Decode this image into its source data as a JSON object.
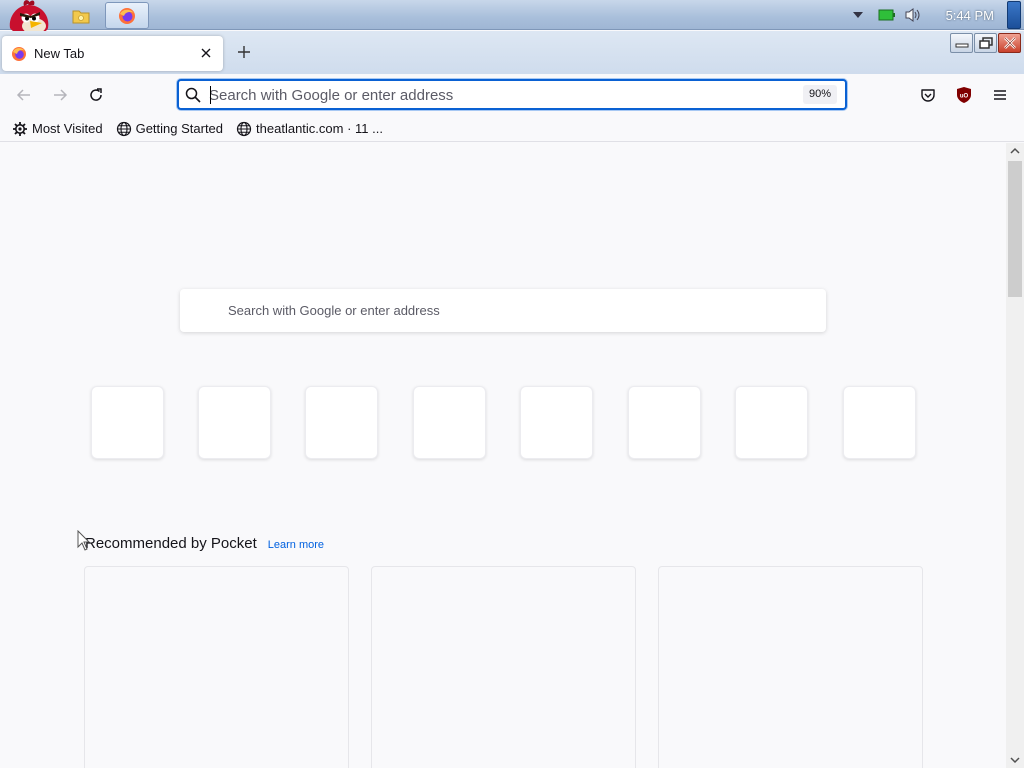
{
  "taskbar": {
    "clock": "5:44 PM",
    "icons": [
      "angry-bird-logo",
      "folder-icon",
      "firefox-icon",
      "chevron-down-icon",
      "battery-icon",
      "volume-icon"
    ]
  },
  "browser": {
    "tab": {
      "title": "New Tab"
    },
    "urlbar": {
      "placeholder": "Search with Google or enter address",
      "value": "",
      "zoom": "90%"
    },
    "bookmarks": [
      {
        "label": "Most Visited",
        "icon": "gear-icon"
      },
      {
        "label": "Getting Started",
        "icon": "globe-icon"
      },
      {
        "label": "theatlantic.com · 11 ...",
        "icon": "globe-icon"
      }
    ]
  },
  "newtab": {
    "search_placeholder": "Search with Google or enter address",
    "topsites_count": 8,
    "pocket": {
      "title": "Recommended by Pocket",
      "learn_more": "Learn more",
      "cards_count": 3
    }
  },
  "colors": {
    "accent": "#0a61d3",
    "link": "#0061e0",
    "page_bg": "#f9f9fb"
  }
}
